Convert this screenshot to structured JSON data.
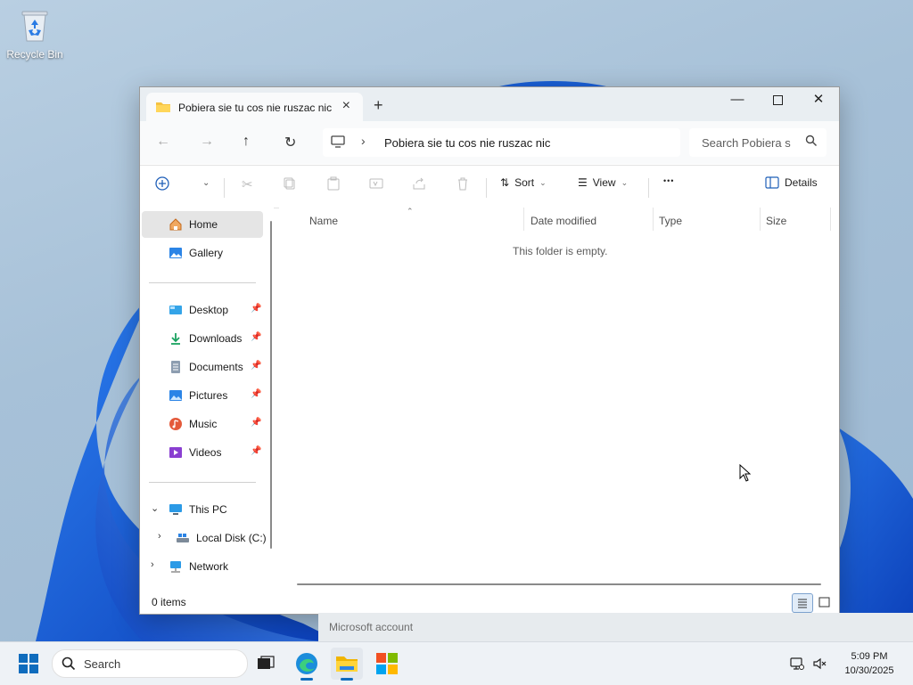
{
  "desktop": {
    "recycle_bin_label": "Recycle Bin"
  },
  "explorer": {
    "tab_title": "Pobiera sie tu cos nie ruszac nic",
    "new_tab": "+",
    "address_path": "Pobiera sie tu cos nie ruszac nic",
    "search_placeholder": "Search Pobiera sie tu cos nie ruszac nic",
    "commands": {
      "sort": "Sort",
      "view": "View",
      "more": "•••",
      "details": "Details"
    },
    "sidebar": {
      "top": [
        {
          "label": "Home",
          "icon": "home-icon",
          "selected": true
        },
        {
          "label": "Gallery",
          "icon": "gallery-icon"
        }
      ],
      "quick_access": [
        {
          "label": "Desktop",
          "icon": "desktop-folder-icon"
        },
        {
          "label": "Downloads",
          "icon": "downloads-icon"
        },
        {
          "label": "Documents",
          "icon": "documents-icon"
        },
        {
          "label": "Pictures",
          "icon": "pictures-icon"
        },
        {
          "label": "Music",
          "icon": "music-icon"
        },
        {
          "label": "Videos",
          "icon": "videos-icon"
        }
      ],
      "this_pc": "This PC",
      "local_disk": "Local Disk (C:)",
      "network": "Network"
    },
    "columns": [
      "Name",
      "Date modified",
      "Type",
      "Size"
    ],
    "empty_message": "This folder is empty.",
    "status_count": "0 items"
  },
  "notification": {
    "text": "Microsoft account"
  },
  "taskbar": {
    "search_label": "Search",
    "apps": [
      "task-view",
      "edge",
      "file-explorer",
      "microsoft-store"
    ],
    "time": "5:09 PM",
    "date": "10/30/2025"
  },
  "colors": {
    "accent": "#0f6cbd",
    "wallpaper_swirl": "#1a5fd6"
  }
}
